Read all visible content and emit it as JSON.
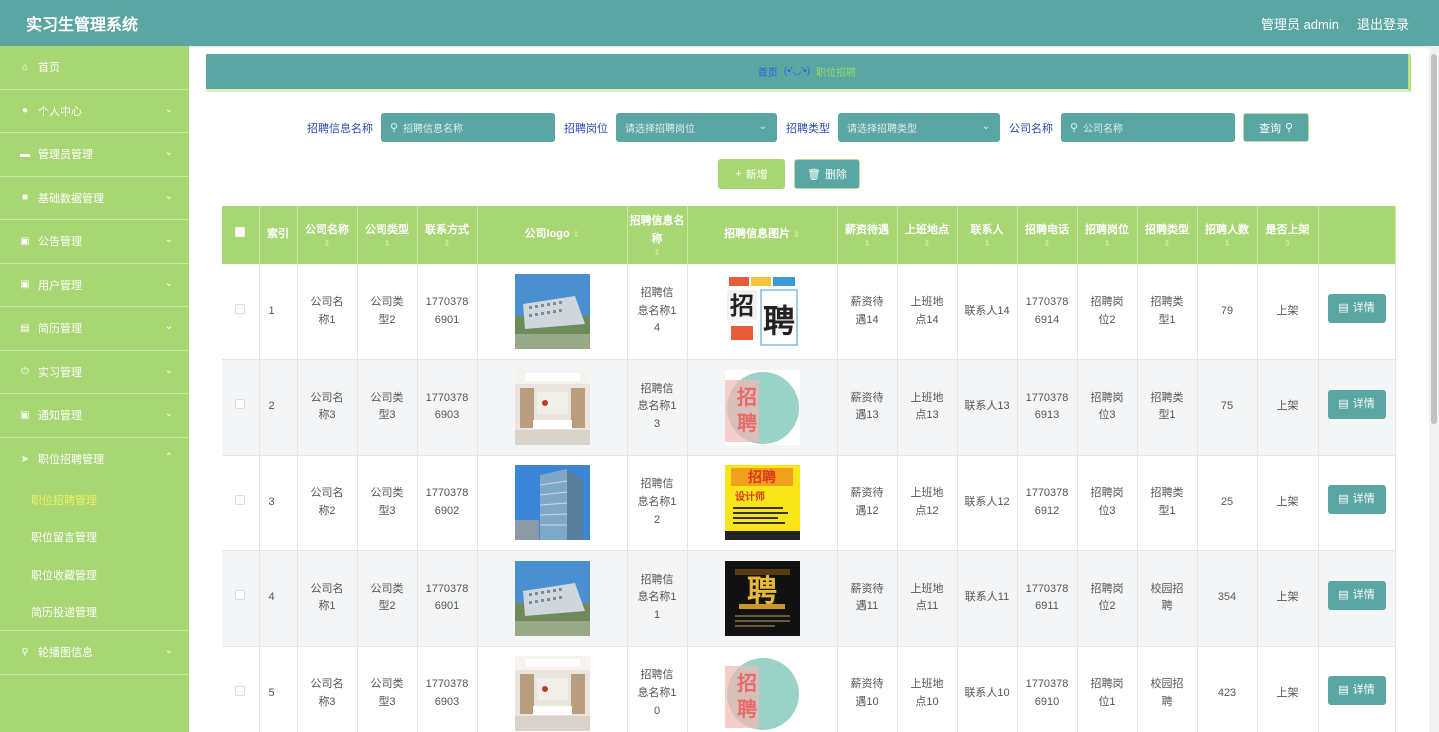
{
  "header": {
    "title": "实习生管理系统",
    "user": "管理员 admin",
    "logout": "退出登录"
  },
  "sidebar": {
    "items": [
      {
        "label": "首页",
        "icon": "home-icon",
        "chev": false
      },
      {
        "label": "个人中心",
        "icon": "user-icon",
        "chev": true
      },
      {
        "label": "管理员管理",
        "icon": "card-icon",
        "chev": true
      },
      {
        "label": "基础数据管理",
        "icon": "briefcase-icon",
        "chev": true
      },
      {
        "label": "公告管理",
        "icon": "clipboard-icon",
        "chev": true
      },
      {
        "label": "用户管理",
        "icon": "clipboard-icon",
        "chev": true
      },
      {
        "label": "简历管理",
        "icon": "chart-icon",
        "chev": true
      },
      {
        "label": "实习管理",
        "icon": "power-icon",
        "chev": true
      },
      {
        "label": "通知管理",
        "icon": "clipboard-check-icon",
        "chev": true
      },
      {
        "label": "职位招聘管理",
        "icon": "send-icon",
        "chev": true,
        "expanded": true
      }
    ],
    "subitems": [
      "职位招聘管理",
      "职位留言管理",
      "职位收藏管理",
      "简历投递管理"
    ],
    "last": {
      "label": "轮播图信息",
      "icon": "pin-icon"
    }
  },
  "breadcrumb": {
    "home": "首页",
    "sep": "(•'◡'•)",
    "current": "职位招聘"
  },
  "search": {
    "name_label": "招聘信息名称",
    "name_placeholder": "招聘信息名称",
    "post_label": "招聘岗位",
    "post_placeholder": "请选择招聘岗位",
    "type_label": "招聘类型",
    "type_placeholder": "请选择招聘类型",
    "company_label": "公司名称",
    "company_placeholder": "公司名称",
    "query": "查询"
  },
  "actions": {
    "add": "新增",
    "delete": "删除",
    "detail": "详情"
  },
  "table": {
    "headers": [
      "索引",
      "公司名称",
      "公司类型",
      "联系方式",
      "公司logo",
      "招聘信息名称",
      "招聘信息图片",
      "薪资待遇",
      "上班地点",
      "联系人",
      "招聘电话",
      "招聘岗位",
      "招聘类型",
      "招聘人数",
      "是否上架"
    ],
    "rows": [
      {
        "idx": "1",
        "company": "公司名称1",
        "ctype": "公司类型2",
        "contact": "17703786901",
        "name": "招聘信息名称14",
        "salary": "薪资待遇14",
        "place": "上班地点14",
        "person": "联系人14",
        "phone": "17703786914",
        "post": "招聘岗位2",
        "rtype": "招聘类型1",
        "count": "79",
        "status": "上架"
      },
      {
        "idx": "2",
        "company": "公司名称3",
        "ctype": "公司类型3",
        "contact": "17703786903",
        "name": "招聘信息名称13",
        "salary": "薪资待遇13",
        "place": "上班地点13",
        "person": "联系人13",
        "phone": "17703786913",
        "post": "招聘岗位3",
        "rtype": "招聘类型1",
        "count": "75",
        "status": "上架"
      },
      {
        "idx": "3",
        "company": "公司名称2",
        "ctype": "公司类型3",
        "contact": "17703786902",
        "name": "招聘信息名称12",
        "salary": "薪资待遇12",
        "place": "上班地点12",
        "person": "联系人12",
        "phone": "17703786912",
        "post": "招聘岗位3",
        "rtype": "招聘类型1",
        "count": "25",
        "status": "上架"
      },
      {
        "idx": "4",
        "company": "公司名称1",
        "ctype": "公司类型2",
        "contact": "17703786901",
        "name": "招聘信息名称11",
        "salary": "薪资待遇11",
        "place": "上班地点11",
        "person": "联系人11",
        "phone": "17703786911",
        "post": "招聘岗位2",
        "rtype": "校园招聘",
        "count": "354",
        "status": "上架"
      },
      {
        "idx": "5",
        "company": "公司名称3",
        "ctype": "公司类型3",
        "contact": "17703786903",
        "name": "招聘信息名称10",
        "salary": "薪资待遇10",
        "place": "上班地点10",
        "person": "联系人10",
        "phone": "17703786910",
        "post": "招聘岗位1",
        "rtype": "校园招聘",
        "count": "423",
        "status": "上架"
      }
    ]
  },
  "poster_text": {
    "p1a": "招",
    "p1b": "聘",
    "p2": "招聘",
    "p3a": "招聘",
    "p3b": "设计师",
    "p4": "聘"
  },
  "colors": {
    "primary": "#5aa6a2",
    "green": "#a8d672",
    "link": "#2c4ab8"
  }
}
